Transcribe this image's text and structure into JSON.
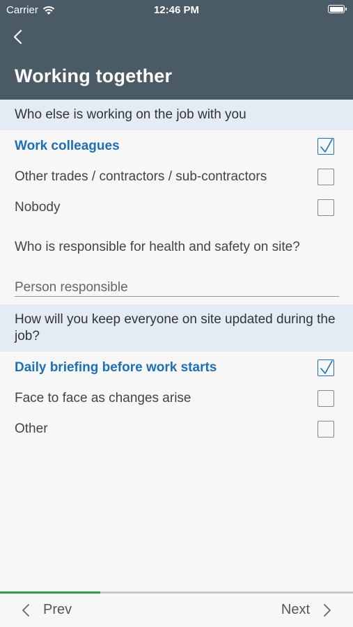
{
  "status_bar": {
    "carrier": "Carrier",
    "time": "12:46 PM"
  },
  "header": {
    "title": "Working together"
  },
  "section1": {
    "title": "Who else is working on the job with you",
    "options": [
      {
        "label": "Work colleagues",
        "checked": true
      },
      {
        "label": "Other trades / contractors / sub-contractors",
        "checked": false
      },
      {
        "label": "Nobody",
        "checked": false
      }
    ]
  },
  "responsible": {
    "question": "Who is responsible for health and safety on site?",
    "placeholder": "Person responsible",
    "value": ""
  },
  "section2": {
    "title": "How will you keep everyone on site updated during the job?",
    "options": [
      {
        "label": "Daily briefing before work starts",
        "checked": true
      },
      {
        "label": "Face to face as changes arise",
        "checked": false
      },
      {
        "label": "Other",
        "checked": false
      }
    ]
  },
  "footer": {
    "prev_label": "Prev",
    "next_label": "Next",
    "progress": 0.285
  },
  "colors": {
    "header_bg": "#4a5b66",
    "accent": "#1f6fb7",
    "section_bg": "#e3ecf5",
    "progress": "#2f9e44"
  }
}
